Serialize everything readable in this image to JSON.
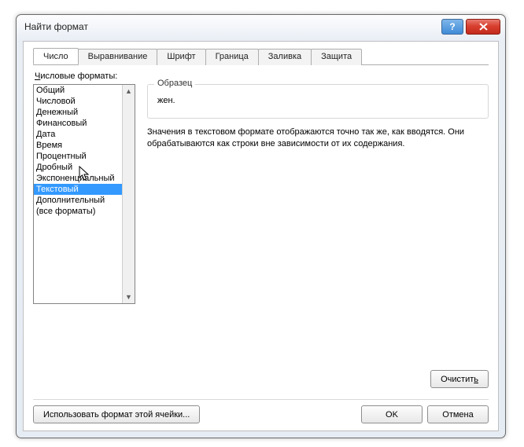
{
  "window": {
    "title": "Найти формат"
  },
  "tabs": [
    {
      "label": "Число",
      "active": true
    },
    {
      "label": "Выравнивание"
    },
    {
      "label": "Шрифт"
    },
    {
      "label": "Граница"
    },
    {
      "label": "Заливка"
    },
    {
      "label": "Защита"
    }
  ],
  "listLabel": "Числовые форматы:",
  "formats": [
    "Общий",
    "Числовой",
    "Денежный",
    "Финансовый",
    "Дата",
    "Время",
    "Процентный",
    "Дробный",
    "Экспоненциальный",
    "Текстовый",
    "Дополнительный",
    "(все форматы)"
  ],
  "selectedIndex": 9,
  "sample": {
    "legend": "Образец",
    "value": "жен."
  },
  "description": "Значения в текстовом формате отображаются точно так же, как вводятся. Они обрабатываются как строки вне зависимости от их содержания.",
  "buttons": {
    "clear": "Очистить",
    "useCellFormat": "Использовать формат этой ячейки...",
    "ok": "OK",
    "cancel": "Отмена"
  }
}
